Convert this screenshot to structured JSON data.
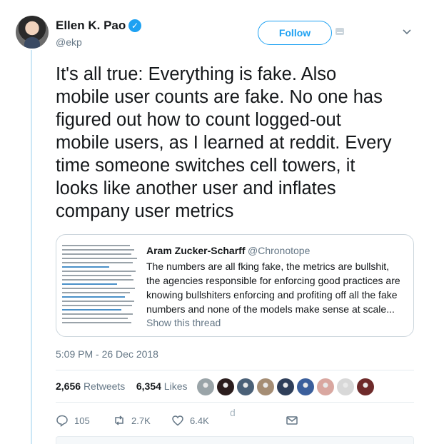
{
  "author": {
    "name": "Ellen K. Pao",
    "handle": "@ekp",
    "verified_mark": "✓"
  },
  "header": {
    "follow_label": "Follow",
    "more_icon": "⌄"
  },
  "tweet": {
    "text": "It's all true: Everything is fake. Also\nmobile user counts are fake. No one has\nfigured out how to count logged-out\nmobile users, as I learned at reddit. Every\ntime someone switches cell towers, it\nlooks like another user and inflates\ncompany user metrics"
  },
  "quote": {
    "author": "Aram Zucker-Scharff",
    "handle": "@Chronotope",
    "text": "The numbers are all fking fake, the metrics are bullshit, the agencies responsible for enforcing good practices are knowing bullshiters enforcing and profiting off all the fake numbers and none of the models make sense at scale...",
    "show_thread": "Show this thread"
  },
  "meta": {
    "timestamp": "5:09 PM - 26 Dec 2018"
  },
  "stats": {
    "retweets_count": "2,656",
    "retweets_label": "Retweets",
    "likes_count": "6,354",
    "likes_label": "Likes",
    "liker_colors": [
      "#9aa4a8",
      "#2b1d1d",
      "#4b6178",
      "#a58d74",
      "#2f3f5a",
      "#3b5f9c",
      "#d9a7a0",
      "#d8d8d8",
      "#6e2a2a"
    ]
  },
  "actions": {
    "replies": "105",
    "retweets": "2.7K",
    "likes": "6.4K",
    "stray_char": "d"
  },
  "colors": {
    "accent": "#1da1f2",
    "muted": "#657786",
    "text": "#14171a",
    "border": "#e6ecf0"
  }
}
